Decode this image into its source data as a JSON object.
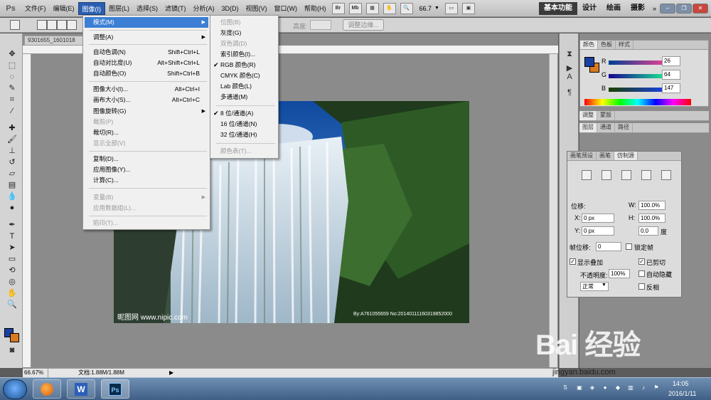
{
  "menubar": {
    "logo": "Ps",
    "items": [
      "文件(F)",
      "编辑(E)",
      "图像(I)",
      "图层(L)",
      "选择(S)",
      "滤镜(T)",
      "分析(A)",
      "3D(D)",
      "视图(V)",
      "窗口(W)",
      "帮助(H)"
    ],
    "icons": [
      "Br",
      "Mb"
    ],
    "zoom": "66.7",
    "workspaces": [
      "基本功能",
      "设计",
      "绘画",
      "摄影"
    ]
  },
  "options": {
    "height_label": "高度:",
    "refine_edge": "调整边缘..."
  },
  "document": {
    "tab": "9301655_1601018",
    "watermark_left": "昵图网 www.nipic.com",
    "watermark_right": "By:A761055659 No:20140111160319852000",
    "status_zoom": "66.67%",
    "status_doc": "文档:1.88M/1.88M"
  },
  "image_menu": {
    "items": [
      {
        "label": "模式(M)",
        "shortcut": "",
        "submenu": true,
        "disabled": false,
        "highlight": true
      },
      {
        "label": "调整(A)",
        "shortcut": "",
        "submenu": true,
        "disabled": false
      },
      {
        "label": "自动色调(N)",
        "shortcut": "Shift+Ctrl+L",
        "disabled": false
      },
      {
        "label": "自动对比度(U)",
        "shortcut": "Alt+Shift+Ctrl+L",
        "disabled": false
      },
      {
        "label": "自动颜色(O)",
        "shortcut": "Shift+Ctrl+B",
        "disabled": false
      },
      {
        "label": "图像大小(I)...",
        "shortcut": "Alt+Ctrl+I",
        "disabled": false
      },
      {
        "label": "画布大小(S)...",
        "shortcut": "Alt+Ctrl+C",
        "disabled": false
      },
      {
        "label": "图像旋转(G)",
        "shortcut": "",
        "submenu": true,
        "disabled": false
      },
      {
        "label": "裁剪(P)",
        "shortcut": "",
        "disabled": true
      },
      {
        "label": "裁切(R)...",
        "shortcut": "",
        "disabled": false
      },
      {
        "label": "显示全部(V)",
        "shortcut": "",
        "disabled": true
      },
      {
        "label": "复制(D)...",
        "shortcut": "",
        "disabled": false
      },
      {
        "label": "应用图像(Y)...",
        "shortcut": "",
        "disabled": false
      },
      {
        "label": "计算(C)...",
        "shortcut": "",
        "disabled": false
      },
      {
        "label": "变量(B)",
        "shortcut": "",
        "submenu": true,
        "disabled": true
      },
      {
        "label": "应用数据组(L)...",
        "shortcut": "",
        "disabled": true
      },
      {
        "label": "陷印(T)...",
        "shortcut": "",
        "disabled": true
      }
    ]
  },
  "mode_menu": {
    "items": [
      {
        "label": "位图(B)",
        "disabled": true,
        "checked": false
      },
      {
        "label": "灰度(G)",
        "disabled": false,
        "checked": false
      },
      {
        "label": "双色调(D)",
        "disabled": true,
        "checked": false
      },
      {
        "label": "索引颜色(I)...",
        "disabled": false,
        "checked": false
      },
      {
        "label": "RGB 颜色(R)",
        "disabled": false,
        "checked": true
      },
      {
        "label": "CMYK 颜色(C)",
        "disabled": false,
        "checked": false
      },
      {
        "label": "Lab 颜色(L)",
        "disabled": false,
        "checked": false
      },
      {
        "label": "多通道(M)",
        "disabled": false,
        "checked": false
      },
      {
        "label": "8 位/通道(A)",
        "disabled": false,
        "checked": true
      },
      {
        "label": "16 位/通道(N)",
        "disabled": false,
        "checked": false
      },
      {
        "label": "32 位/通道(H)",
        "disabled": false,
        "checked": false
      },
      {
        "label": "颜色表(T)...",
        "disabled": true,
        "checked": false
      }
    ]
  },
  "color_panel": {
    "tabs": [
      "颜色",
      "色板",
      "样式"
    ],
    "r_label": "R",
    "g_label": "G",
    "b_label": "B",
    "r": "26",
    "g": "64",
    "b": "147",
    "fg_color": "#1a4093",
    "bg_color": "#d87a20"
  },
  "adj_panel": {
    "tabs": [
      "调整",
      "蒙版"
    ]
  },
  "layers_panel": {
    "tabs": [
      "图层",
      "通道",
      "路径"
    ]
  },
  "clone_panel": {
    "tabs": [
      "画笔预设",
      "画笔",
      "仿制源"
    ],
    "offset_label": "位移:",
    "w_label": "W:",
    "w_value": "100.0%",
    "h_label": "H:",
    "h_value": "100.0%",
    "x_label": "X:",
    "x_value": "0 px",
    "y_label": "Y:",
    "y_value": "0 px",
    "angle_value": "0.0",
    "angle_unit": "度",
    "frame_offset_label": "帧位移:",
    "frame_offset_value": "0",
    "lock_frame_label": "锁定帧",
    "show_overlay_label": "显示叠加",
    "clipped_label": "已剪切",
    "opacity_label": "不透明度:",
    "opacity_value": "100%",
    "auto_hide_label": "自动隐藏",
    "blend_mode": "正常",
    "invert_label": "反相"
  },
  "taskbar": {
    "time": "14:05",
    "date": "2016/1/11",
    "apps": [
      "Firefox",
      "Word",
      "Photoshop"
    ]
  },
  "watermark": {
    "baidu": "Bai 经验",
    "url": "jingyan.baidu.com"
  }
}
